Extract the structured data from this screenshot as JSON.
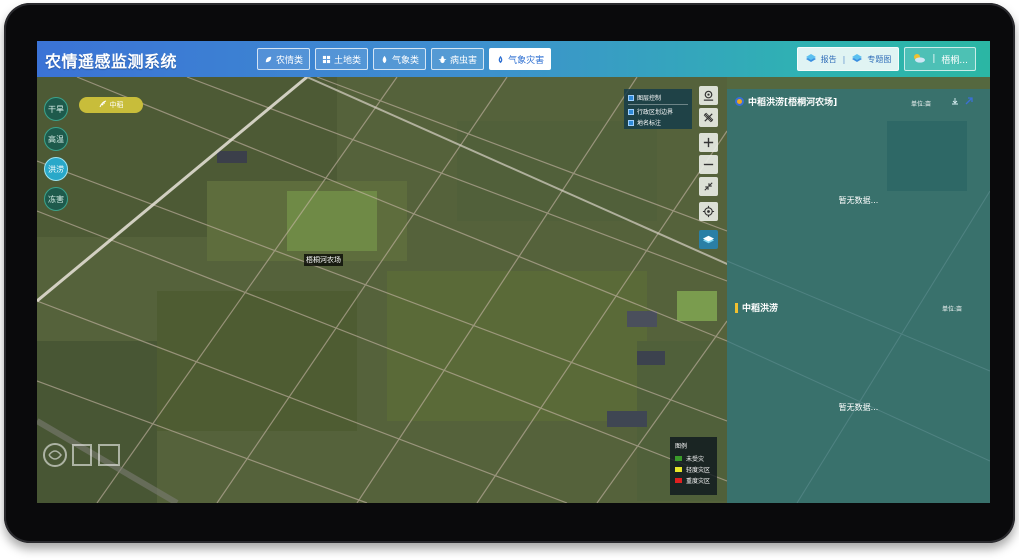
{
  "app": {
    "title": "农情遥感监测系统"
  },
  "nav": {
    "tabs": [
      {
        "label": "农情类",
        "icon": "leaf-icon",
        "active": false
      },
      {
        "label": "土地类",
        "icon": "grid-icon",
        "active": false
      },
      {
        "label": "气象类",
        "icon": "droplet-icon",
        "active": false
      },
      {
        "label": "病虫害",
        "icon": "bug-icon",
        "active": false
      },
      {
        "label": "气象灾害",
        "icon": "alert-drop-icon",
        "active": true
      }
    ]
  },
  "header_right": {
    "report_label": "报告",
    "topic_map_label": "专题图",
    "user_label": "梧桐..."
  },
  "disasters": {
    "items": [
      {
        "label": "干旱",
        "active": false
      },
      {
        "label": "高温",
        "active": false
      },
      {
        "label": "洪涝",
        "active": true
      },
      {
        "label": "冻害",
        "active": false
      }
    ],
    "crop_label": "中稻"
  },
  "map": {
    "farm_label": "梧桐河农场"
  },
  "layer_control": {
    "title": "图层控制",
    "items": [
      "行政区划边界",
      "地名标注"
    ]
  },
  "panels": {
    "top": {
      "title": "中稻洪涝[梧桐河农场]",
      "unit": "单位:亩",
      "empty_text": "暂无数据..."
    },
    "bottom": {
      "title": "中稻洪涝",
      "unit": "单位:亩",
      "empty_text": "暂无数据..."
    }
  },
  "legend": {
    "title": "图例",
    "items": [
      {
        "label": "未受灾",
        "color": "#3a9a2a"
      },
      {
        "label": "轻度灾区",
        "color": "#e6e62a"
      },
      {
        "label": "重度灾区",
        "color": "#e02020"
      }
    ]
  },
  "colors": {
    "accent": "#2d6fd2",
    "panel": "#28788a",
    "active_disaster": "#29a8c9"
  }
}
